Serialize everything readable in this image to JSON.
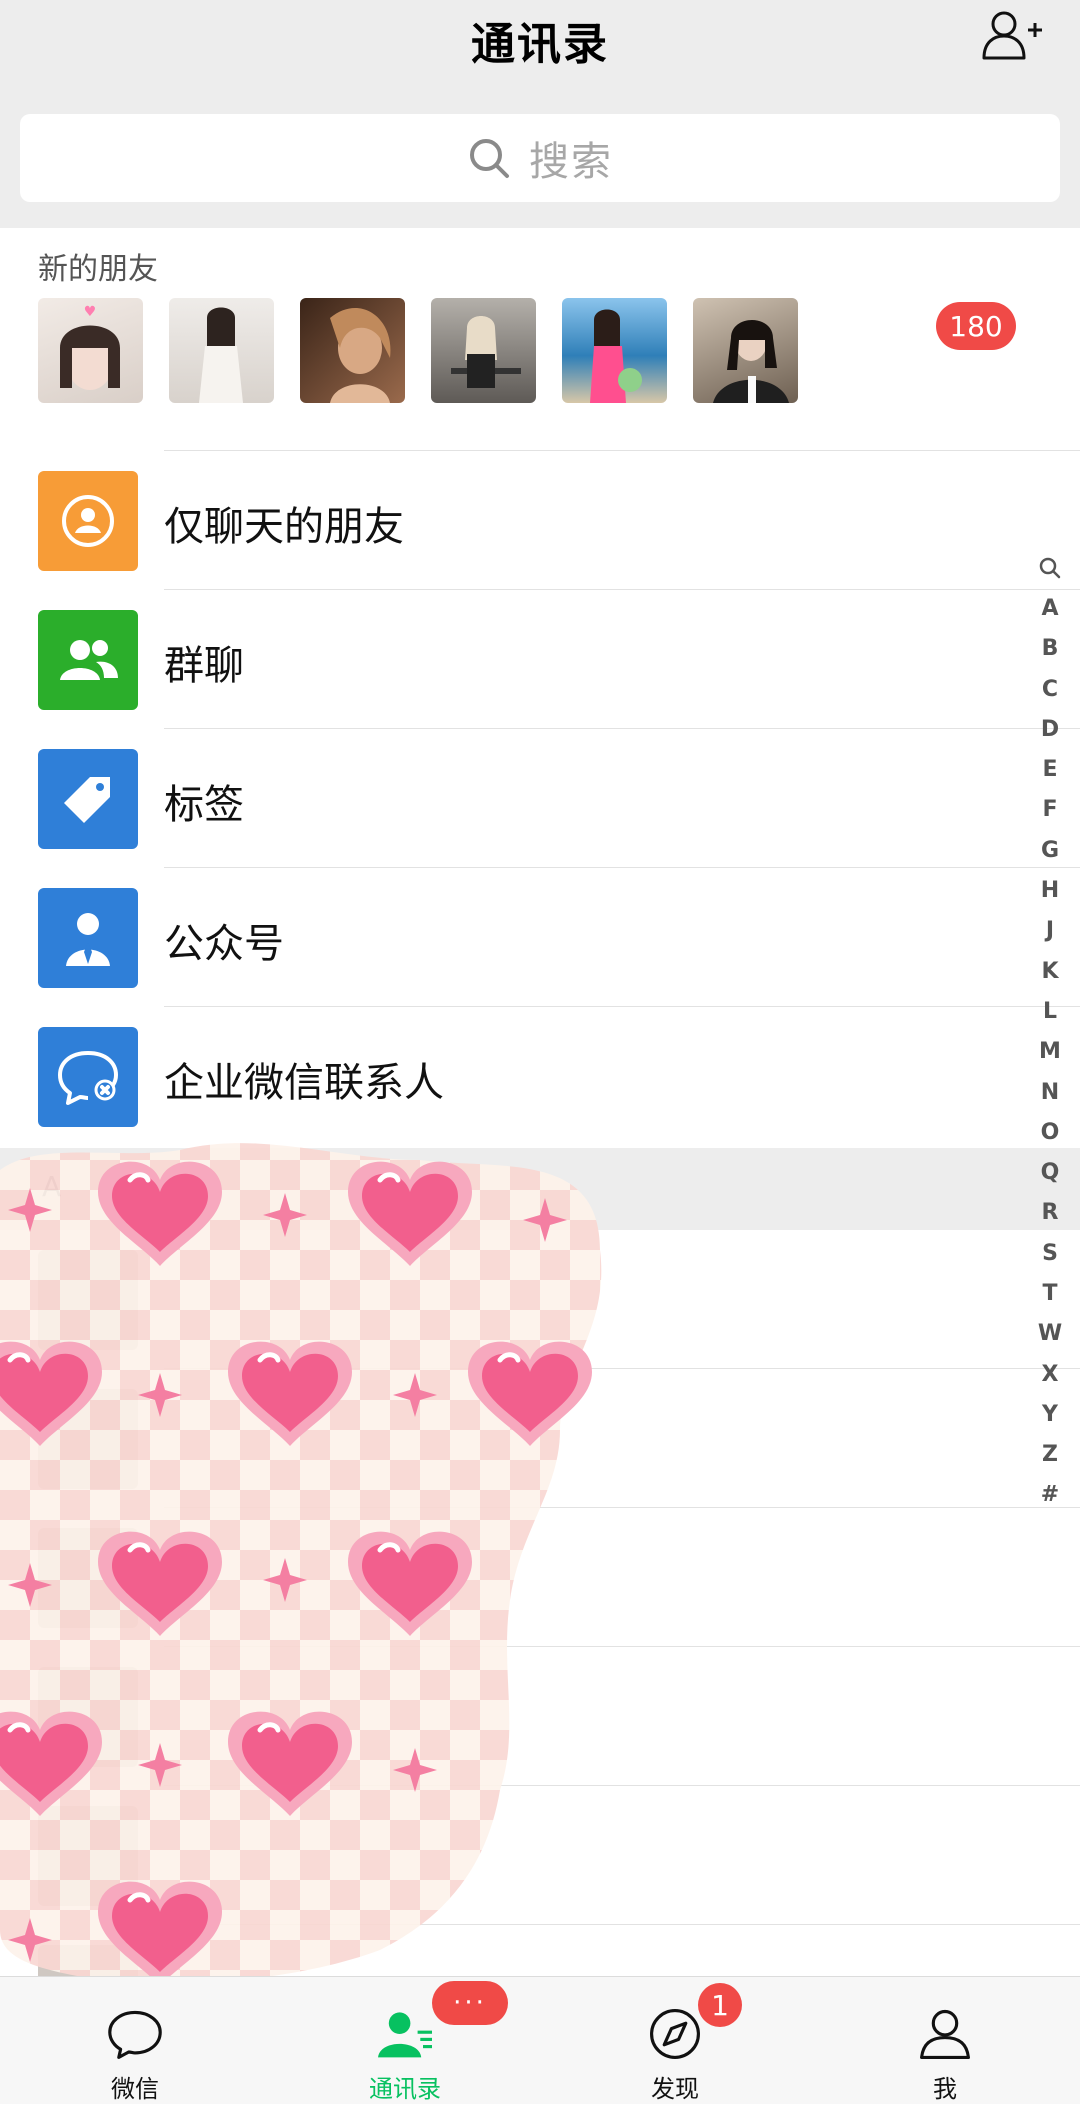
{
  "header": {
    "title": "通讯录",
    "add_friend_icon": "add-user-icon",
    "search_placeholder": "搜索"
  },
  "new_friends": {
    "label": "新的朋友",
    "badge": "180",
    "avatars": [
      {
        "name": "avatar-1",
        "color": "#e6dcd6"
      },
      {
        "name": "avatar-2",
        "color": "#ece8e4"
      },
      {
        "name": "avatar-3",
        "color": "#7c5a44"
      },
      {
        "name": "avatar-4",
        "color": "#8d8a85"
      },
      {
        "name": "avatar-5",
        "color": "#3d8fc2"
      },
      {
        "name": "avatar-6",
        "color": "#5a4a3e"
      }
    ]
  },
  "menu": [
    {
      "label": "仅聊天的朋友",
      "icon": "chat-only-friend-icon",
      "color": "#f79c37"
    },
    {
      "label": "群聊",
      "icon": "group-chat-icon",
      "color": "#2bae2b"
    },
    {
      "label": "标签",
      "icon": "tag-icon",
      "color": "#2f7fd8"
    },
    {
      "label": "公众号",
      "icon": "official-account-icon",
      "color": "#2f7fd8"
    },
    {
      "label": "企业微信联系人",
      "icon": "work-contacts-icon",
      "color": "#2f7fd8"
    }
  ],
  "section": {
    "letter": "A"
  },
  "index": [
    "A",
    "B",
    "C",
    "D",
    "E",
    "F",
    "G",
    "H",
    "J",
    "K",
    "L",
    "M",
    "N",
    "O",
    "Q",
    "R",
    "S",
    "T",
    "W",
    "X",
    "Y",
    "Z",
    "#"
  ],
  "tabbar": {
    "tabs": [
      {
        "label": "微信",
        "icon": "chat-bubble-icon"
      },
      {
        "label": "通讯录",
        "icon": "contacts-icon",
        "badge": "···"
      },
      {
        "label": "发现",
        "icon": "compass-icon",
        "badge": "1"
      },
      {
        "label": "我",
        "icon": "person-icon"
      }
    ],
    "active_color": "#07c160"
  }
}
